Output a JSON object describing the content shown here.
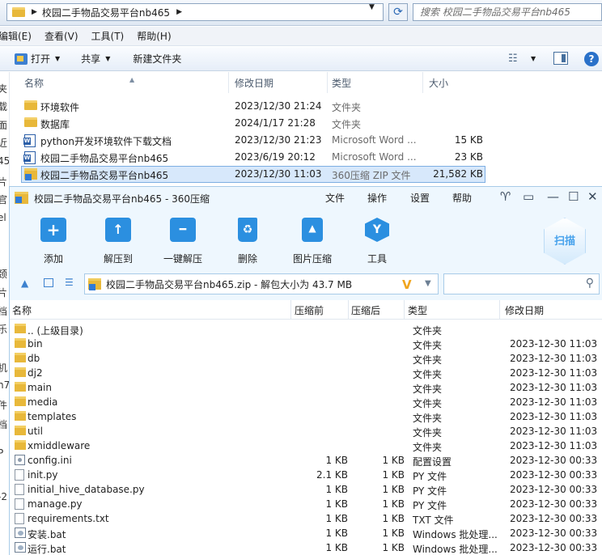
{
  "explorer": {
    "address_path": "校园二手物品交易平台nb465",
    "search_placeholder": "搜索 校园二手物品交易平台nb465",
    "menu": [
      "编辑(E)",
      "查看(V)",
      "工具(T)",
      "帮助(H)"
    ],
    "commands": {
      "open": "打开",
      "share": "共享",
      "new_folder": "新建文件夹"
    },
    "nav_fragments": [
      "夹",
      "载",
      "面",
      "近",
      "45",
      "片",
      "官",
      "el",
      "颈",
      "片",
      "档",
      "乐",
      "机",
      "n7",
      "件",
      "档",
      "· P",
      "-2"
    ],
    "columns": {
      "name": "名称",
      "modified": "修改日期",
      "type": "类型",
      "size": "大小"
    },
    "files": [
      {
        "name": "环境软件",
        "modified": "2023/12/30 21:24",
        "type": "文件夹",
        "size": "",
        "icon": "folder-icon"
      },
      {
        "name": "数据库",
        "modified": "2024/1/17 21:28",
        "type": "文件夹",
        "size": "",
        "icon": "folder-icon"
      },
      {
        "name": "python开发环境软件下载文档",
        "modified": "2023/12/30 21:23",
        "type": "Microsoft Word ...",
        "size": "15 KB",
        "icon": "word-document-icon"
      },
      {
        "name": "校园二手物品交易平台nb465",
        "modified": "2023/6/19 20:12",
        "type": "Microsoft Word ...",
        "size": "23 KB",
        "icon": "word-document-icon"
      },
      {
        "name": "校园二手物品交易平台nb465",
        "modified": "2023/12/30 11:03",
        "type": "360压缩 ZIP 文件",
        "size": "21,582 KB",
        "icon": "zip-archive-icon",
        "selected": true
      }
    ]
  },
  "zip": {
    "title": "校园二手物品交易平台nb465 - 360压缩",
    "menu": [
      "文件",
      "操作",
      "设置",
      "帮助"
    ],
    "toolbar": [
      "添加",
      "解压到",
      "一键解压",
      "删除",
      "图片压缩",
      "工具"
    ],
    "scan_label": "扫描",
    "path": "校园二手物品交易平台nb465.zip - 解包大小为 43.7 MB",
    "columns": {
      "name": "名称",
      "packed": "压缩前",
      "size": "压缩后",
      "type": "类型",
      "modified": "修改日期"
    },
    "rows": [
      {
        "name": ".. (上级目录)",
        "packed": "",
        "size": "",
        "type": "文件夹",
        "modified": "",
        "icon": "folder-icon"
      },
      {
        "name": "bin",
        "packed": "",
        "size": "",
        "type": "文件夹",
        "modified": "2023-12-30 11:03",
        "icon": "folder-icon"
      },
      {
        "name": "db",
        "packed": "",
        "size": "",
        "type": "文件夹",
        "modified": "2023-12-30 11:03",
        "icon": "folder-icon"
      },
      {
        "name": "dj2",
        "packed": "",
        "size": "",
        "type": "文件夹",
        "modified": "2023-12-30 11:03",
        "icon": "folder-icon"
      },
      {
        "name": "main",
        "packed": "",
        "size": "",
        "type": "文件夹",
        "modified": "2023-12-30 11:03",
        "icon": "folder-icon"
      },
      {
        "name": "media",
        "packed": "",
        "size": "",
        "type": "文件夹",
        "modified": "2023-12-30 11:03",
        "icon": "folder-icon"
      },
      {
        "name": "templates",
        "packed": "",
        "size": "",
        "type": "文件夹",
        "modified": "2023-12-30 11:03",
        "icon": "folder-icon"
      },
      {
        "name": "util",
        "packed": "",
        "size": "",
        "type": "文件夹",
        "modified": "2023-12-30 11:03",
        "icon": "folder-icon"
      },
      {
        "name": "xmiddleware",
        "packed": "",
        "size": "",
        "type": "文件夹",
        "modified": "2023-12-30 11:03",
        "icon": "folder-icon"
      },
      {
        "name": "config.ini",
        "packed": "1 KB",
        "size": "1 KB",
        "type": "配置设置",
        "modified": "2023-12-30 00:33",
        "icon": "config-file-icon"
      },
      {
        "name": "init.py",
        "packed": "2.1 KB",
        "size": "1 KB",
        "type": "PY 文件",
        "modified": "2023-12-30 00:33",
        "icon": "file-icon"
      },
      {
        "name": "initial_hive_database.py",
        "packed": "1 KB",
        "size": "1 KB",
        "type": "PY 文件",
        "modified": "2023-12-30 00:33",
        "icon": "file-icon"
      },
      {
        "name": "manage.py",
        "packed": "1 KB",
        "size": "1 KB",
        "type": "PY 文件",
        "modified": "2023-12-30 00:33",
        "icon": "file-icon"
      },
      {
        "name": "requirements.txt",
        "packed": "1 KB",
        "size": "1 KB",
        "type": "TXT 文件",
        "modified": "2023-12-30 00:33",
        "icon": "file-icon"
      },
      {
        "name": "安装.bat",
        "packed": "1 KB",
        "size": "1 KB",
        "type": "Windows 批处理...",
        "modified": "2023-12-30 00:33",
        "icon": "batch-file-icon"
      },
      {
        "name": "运行.bat",
        "packed": "1 KB",
        "size": "1 KB",
        "type": "Windows 批处理...",
        "modified": "2023-12-30 00:33",
        "icon": "batch-file-icon"
      }
    ]
  }
}
